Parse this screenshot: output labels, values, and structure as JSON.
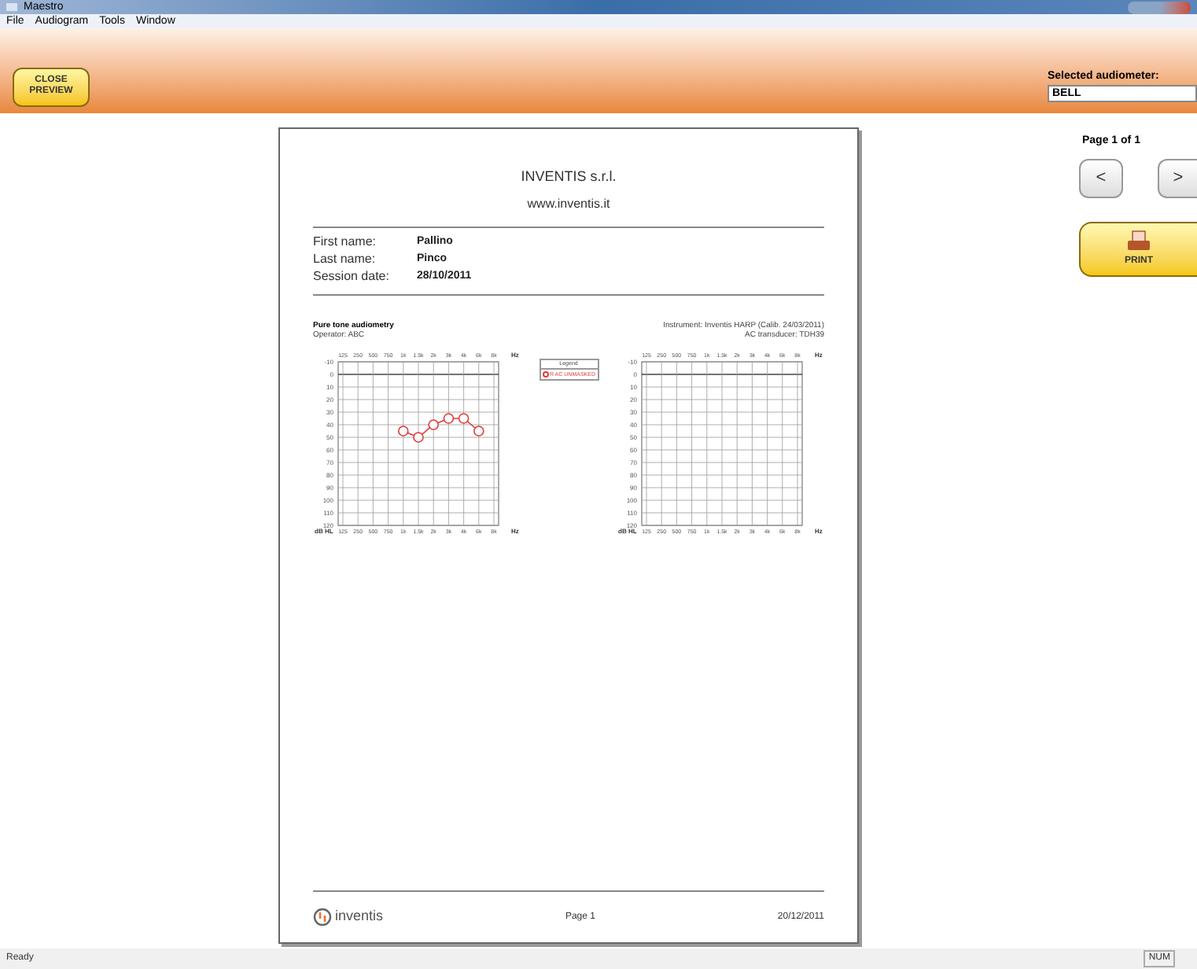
{
  "window": {
    "title": "Maestro"
  },
  "menu": [
    "File",
    "Audiogram",
    "Tools",
    "Window"
  ],
  "toolbar": {
    "close_button": [
      "CLOSE",
      "PREVIEW"
    ],
    "audiometer_label": "Selected audiometer:",
    "audiometer_value": "BELL"
  },
  "report": {
    "company": "INVENTIS s.r.l.",
    "website": "www.inventis.it",
    "fields": [
      {
        "label": "First name:",
        "value": "Pallino"
      },
      {
        "label": "Last name:",
        "value": "Pinco"
      },
      {
        "label": "Session date:",
        "value": "28/10/2011"
      }
    ],
    "section_title": "Pure tone audiometry",
    "operator": "Operator: ABC",
    "instrument": "Instrument: Inventis HARP (Calib. 24/03/2011)",
    "transducer": "AC transducer: TDH39",
    "legend": {
      "title": "Legend"
    },
    "charts": [
      {
        "chart_data": {
          "type": "line",
          "xlabel": "Hz",
          "ylabel": "dB HL",
          "categories": [
            "125",
            "250",
            "500",
            "750",
            "1k",
            "1.5k",
            "2k",
            "3k",
            "4k",
            "6k",
            "8k"
          ],
          "grid": true,
          "series": [
            {
              "name": "R AC UNMASKED",
              "color": "#e03a3a",
              "marker": "circle",
              "values": [
                null,
                null,
                null,
                null,
                45,
                50,
                40,
                35,
                35,
                45,
                null
              ]
            }
          ],
          "ylim": [
            120,
            -10
          ],
          "yticks": [
            -10,
            0,
            10,
            20,
            30,
            40,
            50,
            60,
            70,
            80,
            90,
            100,
            110,
            120
          ]
        }
      },
      {
        "chart_data": {
          "type": "line",
          "xlabel": "Hz",
          "ylabel": "dB HL",
          "categories": [
            "125",
            "250",
            "500",
            "750",
            "1k",
            "1.5k",
            "2k",
            "3k",
            "4k",
            "6k",
            "8k"
          ],
          "grid": true,
          "ylim": [
            120,
            -10
          ],
          "yticks": [
            -10,
            0,
            10,
            20,
            30,
            40,
            50,
            60,
            70,
            80,
            90,
            100,
            110,
            120
          ]
        }
      }
    ],
    "footer": {
      "logo_text": "inventis",
      "page": "Page 1",
      "date": "20/12/2011"
    }
  },
  "pager": {
    "label": "Page 1 of 1",
    "prev": "<",
    "next": ">",
    "print": "PRINT"
  },
  "status_bar": {
    "text": "Ready",
    "indicator": "NUM"
  }
}
